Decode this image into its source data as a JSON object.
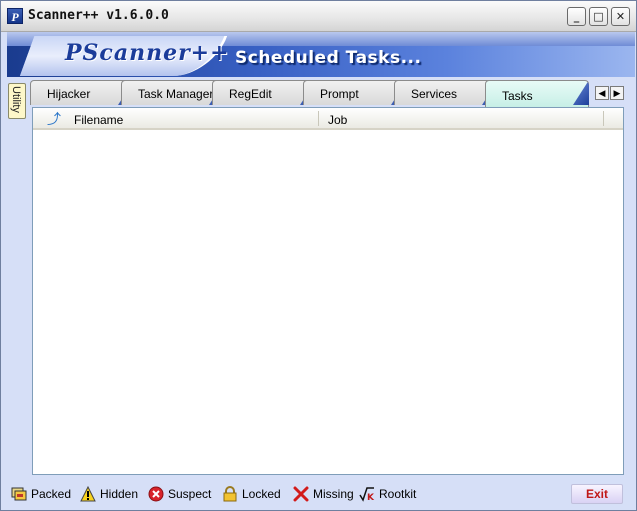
{
  "window": {
    "title": "Scanner++ v1.6.0.0",
    "app_icon_letter": "P"
  },
  "title_buttons": {
    "minimize": "_",
    "maximize": "□",
    "close": "✕"
  },
  "banner": {
    "logo": "PScanner++",
    "title": "Scheduled Tasks..."
  },
  "side_tab": {
    "label": "Utility"
  },
  "tabs": [
    {
      "label": "Hijacker"
    },
    {
      "label": "Task Manager"
    },
    {
      "label": "RegEdit"
    },
    {
      "label": "Prompt"
    },
    {
      "label": "Services"
    },
    {
      "label": "Tasks"
    }
  ],
  "active_tab": "Tasks",
  "tab_nav": {
    "prev": "◀",
    "next": "▶"
  },
  "table": {
    "columns": [
      "Filename",
      "Job"
    ],
    "rows": []
  },
  "legend": [
    {
      "label": "Packed",
      "icon": "packed-icon"
    },
    {
      "label": "Hidden",
      "icon": "warning-icon"
    },
    {
      "label": "Suspect",
      "icon": "suspect-icon"
    },
    {
      "label": "Locked",
      "icon": "lock-icon"
    },
    {
      "label": "Missing",
      "icon": "missing-icon"
    },
    {
      "label": "Rootkit",
      "icon": "rootkit-icon"
    }
  ],
  "exit_button": {
    "label": "Exit"
  },
  "colors": {
    "accent": "#1d3f9a",
    "exit_text": "#c01818",
    "active_tab": "#c7efe6"
  }
}
